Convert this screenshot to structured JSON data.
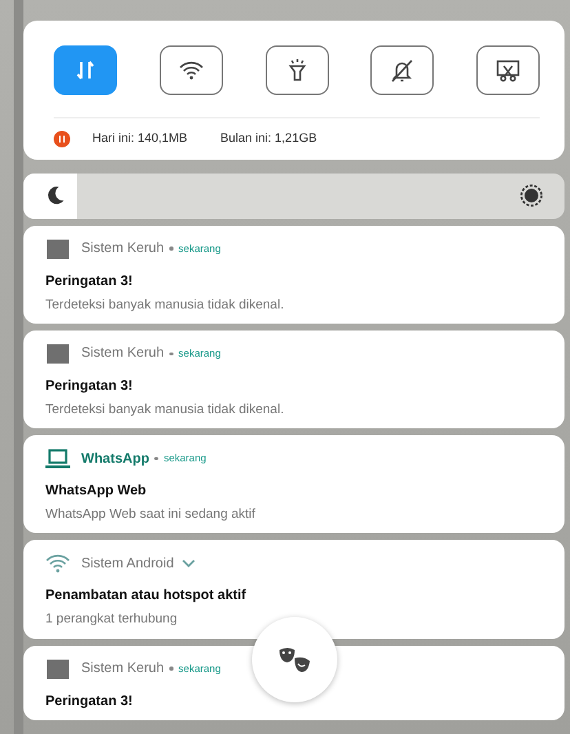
{
  "toggles": [
    {
      "kind": "data",
      "selected": true
    },
    {
      "kind": "wifi",
      "selected": false
    },
    {
      "kind": "flashlight",
      "selected": false
    },
    {
      "kind": "bell-off",
      "selected": false
    },
    {
      "kind": "screenshot",
      "selected": false
    }
  ],
  "data_usage": {
    "today": "Hari ini: 140,1MB",
    "month": "Bulan ini: 1,21GB"
  },
  "brightness": {
    "level": 0.1
  },
  "notifications": [
    {
      "kind": "square",
      "app": "Sistem Keruh",
      "time": "sekarang",
      "expandable": false,
      "title": "Peringatan 3!",
      "body": "Terdeteksi banyak manusia tidak dikenal."
    },
    {
      "kind": "square",
      "app": "Sistem Keruh",
      "time": "sekarang",
      "expandable": false,
      "title": "Peringatan 3!",
      "body": "Terdeteksi banyak manusia tidak dikenal."
    },
    {
      "kind": "laptop",
      "app": "WhatsApp",
      "time": "sekarang",
      "expandable": false,
      "title": "WhatsApp Web",
      "body": "WhatsApp Web saat ini sedang aktif"
    },
    {
      "kind": "wifi",
      "app": "Sistem Android",
      "expandable": true,
      "title": "Penambatan atau hotspot aktif",
      "body": "1 perangkat terhubung"
    },
    {
      "kind": "square",
      "app": "Sistem Keruh",
      "time": "sekarang",
      "expandable": false,
      "title": "Peringatan 3!"
    }
  ]
}
